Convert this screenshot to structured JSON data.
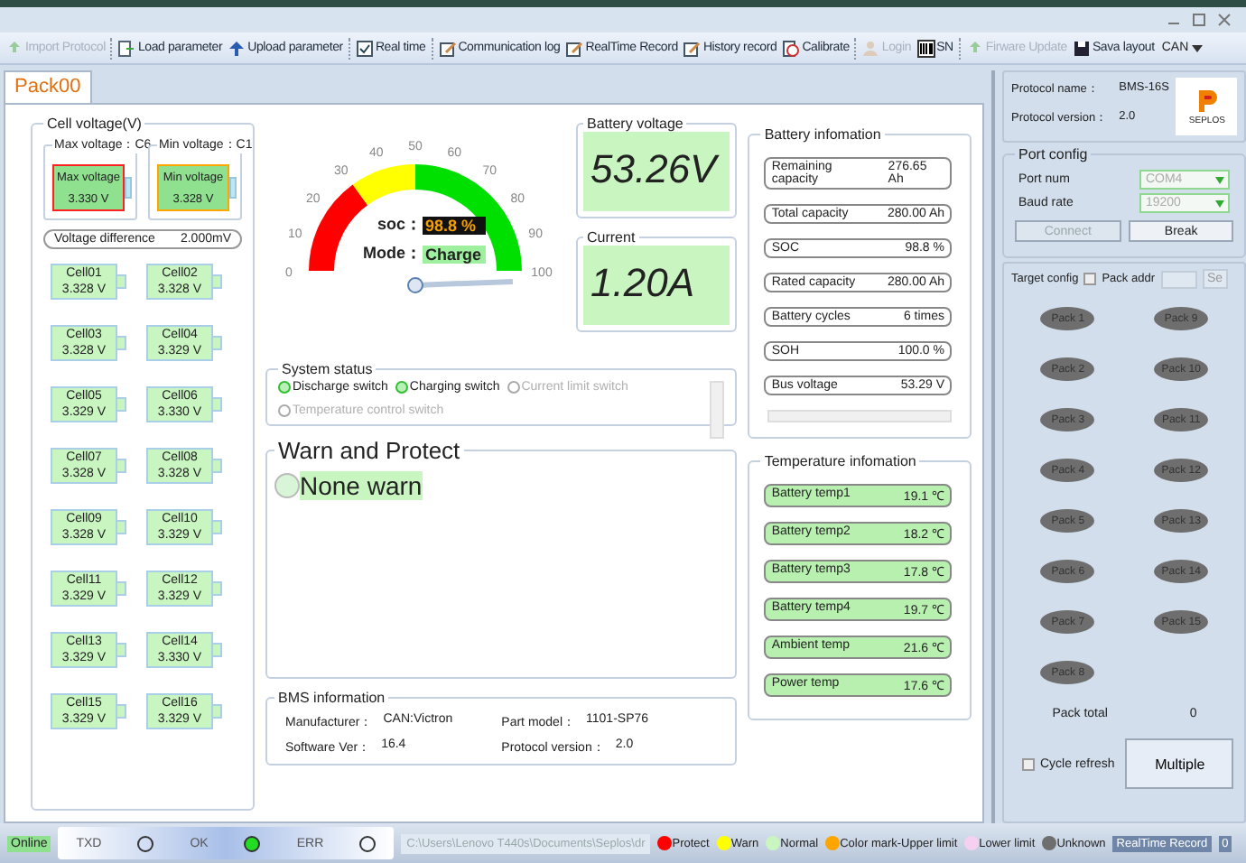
{
  "toolbar": [
    {
      "label": "Import Protocol",
      "disabled": true
    },
    {
      "label": "Load parameter",
      "disabled": false
    },
    {
      "label": "Upload parameter",
      "disabled": false
    },
    {
      "label": "Real time",
      "disabled": false
    },
    {
      "label": "Communication log",
      "disabled": false
    },
    {
      "label": "RealTime Record",
      "disabled": false
    },
    {
      "label": "History record",
      "disabled": false
    },
    {
      "label": "Calibrate",
      "disabled": false
    },
    {
      "label": "Login",
      "disabled": true
    },
    {
      "label": "SN",
      "disabled": false
    },
    {
      "label": "Firware Update",
      "disabled": true
    },
    {
      "label": "Sava layout",
      "disabled": false
    }
  ],
  "layout_select": "CAN",
  "tabs": [
    {
      "label": "Pack00",
      "selected": true
    }
  ],
  "cell_voltage": {
    "title": "Cell voltage(V)",
    "max": {
      "title": "Max voltage：C6",
      "label": "Max voltage",
      "value": "3.330 V"
    },
    "min": {
      "title": "Min voltage：C1",
      "label": "Min voltage",
      "value": "3.328 V"
    },
    "difference": {
      "label": "Voltage difference",
      "value": "2.000mV"
    },
    "cells": [
      {
        "name": "Cell01",
        "value": "3.328 V"
      },
      {
        "name": "Cell02",
        "value": "3.328 V"
      },
      {
        "name": "Cell03",
        "value": "3.328 V"
      },
      {
        "name": "Cell04",
        "value": "3.329 V"
      },
      {
        "name": "Cell05",
        "value": "3.329 V"
      },
      {
        "name": "Cell06",
        "value": "3.330 V"
      },
      {
        "name": "Cell07",
        "value": "3.328 V"
      },
      {
        "name": "Cell08",
        "value": "3.328 V"
      },
      {
        "name": "Cell09",
        "value": "3.328 V"
      },
      {
        "name": "Cell10",
        "value": "3.329 V"
      },
      {
        "name": "Cell11",
        "value": "3.329 V"
      },
      {
        "name": "Cell12",
        "value": "3.329 V"
      },
      {
        "name": "Cell13",
        "value": "3.329 V"
      },
      {
        "name": "Cell14",
        "value": "3.330 V"
      },
      {
        "name": "Cell15",
        "value": "3.329 V"
      },
      {
        "name": "Cell16",
        "value": "3.329 V"
      }
    ]
  },
  "gauge": {
    "ticks": [
      "0",
      "10",
      "20",
      "30",
      "40",
      "50",
      "60",
      "70",
      "80",
      "90",
      "100"
    ],
    "level": 0.988,
    "soc_label": "soc：",
    "soc_value": "98.8 %",
    "mode_label": "Mode：",
    "mode_value": "Charge"
  },
  "battery_voltage": {
    "title": "Battery voltage",
    "value": "53.26V"
  },
  "current": {
    "title": "Current",
    "value": "1.20A"
  },
  "system_status": {
    "title": "System status",
    "switches": [
      {
        "label": "Discharge switch",
        "on": true
      },
      {
        "label": "Charging switch",
        "on": true
      },
      {
        "label": "Current limit switch",
        "on": false
      },
      {
        "label": "Temperature control switch",
        "on": false
      }
    ]
  },
  "warn": {
    "title": "Warn and Protect",
    "items": [
      {
        "label": "None warn"
      }
    ]
  },
  "bms_info": {
    "title": "BMS information",
    "fields": [
      {
        "label": "Manufacturer：",
        "value": "CAN:Victron"
      },
      {
        "label": "Part model：",
        "value": "1101-SP76"
      },
      {
        "label": "Software Ver：",
        "value": "16.4"
      },
      {
        "label": "Protocol version：",
        "value": "2.0"
      }
    ]
  },
  "battery_info": {
    "title": "Battery infomation",
    "rows": [
      {
        "label": "Remaining capacity",
        "value": "276.65 Ah"
      },
      {
        "label": "Total capacity",
        "value": "280.00 Ah"
      },
      {
        "label": "SOC",
        "value": "98.8 %"
      },
      {
        "label": "Rated capacity",
        "value": "280.00 Ah"
      },
      {
        "label": "Battery cycles",
        "value": "6 times"
      },
      {
        "label": "SOH",
        "value": "100.0 %"
      },
      {
        "label": "Bus voltage",
        "value": "53.29 V"
      }
    ]
  },
  "temperature": {
    "title": "Temperature infomation",
    "rows": [
      {
        "label": "Battery temp1",
        "value": "19.1 ℃"
      },
      {
        "label": "Battery temp2",
        "value": "18.2 ℃"
      },
      {
        "label": "Battery temp3",
        "value": "17.8 ℃"
      },
      {
        "label": "Battery temp4",
        "value": "19.7 ℃"
      },
      {
        "label": "Ambient temp",
        "value": "21.6 ℃"
      },
      {
        "label": "Power temp",
        "value": "17.6 ℃"
      }
    ]
  },
  "protocol": {
    "fields": [
      {
        "label": "Protocol name：",
        "value": "BMS-16S"
      },
      {
        "label": "Protocol version：",
        "value": "2.0"
      }
    ],
    "logo_text": "SEPLOS"
  },
  "port_config": {
    "title": "Port config",
    "fields": [
      {
        "label": "Port num",
        "value": "COM4",
        "disabled": true
      },
      {
        "label": "Baud rate",
        "value": "19200",
        "disabled": true
      }
    ],
    "buttons": [
      {
        "label": "Connect",
        "disabled": true
      },
      {
        "label": "Break",
        "disabled": false
      }
    ]
  },
  "target_config": {
    "title": "Target config",
    "pack_addr": {
      "label": "Pack addr",
      "checked": false
    },
    "set_button": "Se",
    "packs": [
      "Pack 1",
      "Pack 2",
      "Pack 3",
      "Pack 4",
      "Pack 5",
      "Pack 6",
      "Pack 7",
      "Pack 8",
      "Pack 9",
      "Pack 10",
      "Pack 11",
      "Pack 12",
      "Pack 13",
      "Pack 14",
      "Pack 15"
    ],
    "total_label": "Pack total",
    "total_value": "0",
    "cycle_refresh": {
      "label": "Cycle refresh",
      "checked": false
    },
    "multiple_button": "Multiple"
  },
  "status_bar": {
    "online": "Online",
    "indicators": [
      {
        "label": "TXD",
        "on": false
      },
      {
        "label": "OK",
        "on": true
      },
      {
        "label": "ERR",
        "on": false
      }
    ],
    "path": "C:\\Users\\Lenovo T440s\\Documents\\Seplos\\dr",
    "legend": [
      {
        "label": "Protect",
        "color": "#ff0000"
      },
      {
        "label": "Warn",
        "color": "#ffff00"
      },
      {
        "label": "Normal",
        "color": "#c8f5c0"
      },
      {
        "label": "Color mark-Upper limit",
        "color": "#ffa500"
      },
      {
        "label": "Lower limit",
        "color": "#f5d0f0"
      },
      {
        "label": "Unknown",
        "color": "#6e6e6e"
      }
    ],
    "record_label": "RealTime Record",
    "record_value": "0"
  }
}
